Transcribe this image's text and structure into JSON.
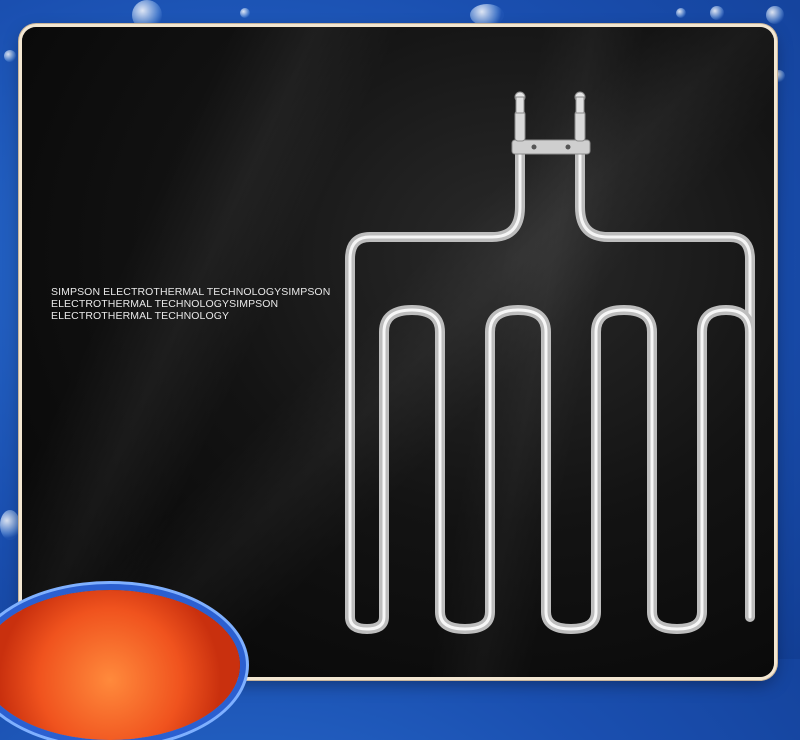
{
  "tagline": "SIMPSON ELECTROTHERMAL TECHNOLOGYSIMPSON ELECTROTHERMAL TECHNOLOGYSIMPSON ELECTROTHERMAL TECHNOLOGY",
  "colors": {
    "background_blue": "#1a4fb0",
    "card_black": "#0b0b0b",
    "border_cream": "#f3e7d2",
    "badge_orange": "#f0531e"
  }
}
